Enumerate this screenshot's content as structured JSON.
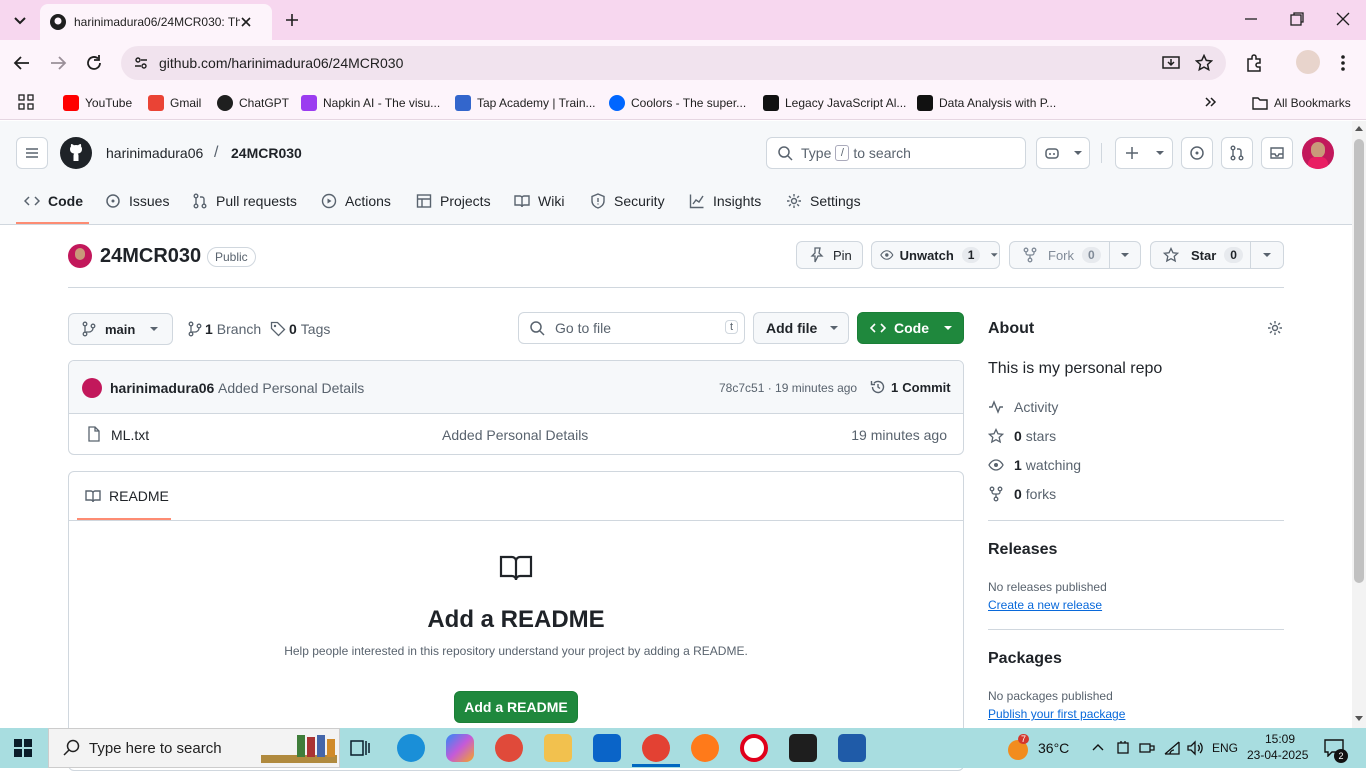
{
  "browser": {
    "tab_title": "harinimadura06/24MCR030: Th",
    "url": "github.com/harinimadura06/24MCR030",
    "bookmarks": [
      {
        "label": "YouTube",
        "color": "#ff0000"
      },
      {
        "label": "Gmail",
        "color": "#ea4335"
      },
      {
        "label": "ChatGPT",
        "color": "#1f1f1f"
      },
      {
        "label": "Napkin AI - The visu...",
        "color": "#9b3cf0"
      },
      {
        "label": "Tap Academy | Train...",
        "color": "#3366cc"
      },
      {
        "label": "Coolors - The super...",
        "color": "#0066ff"
      },
      {
        "label": "Legacy JavaScript Al...",
        "color": "#111111"
      },
      {
        "label": "Data Analysis with P...",
        "color": "#111111"
      }
    ],
    "all_bookmarks": "All Bookmarks"
  },
  "header": {
    "owner": "harinimadura06",
    "separator": "/",
    "repo": "24MCR030",
    "search_prefix": "Type",
    "search_key": "/",
    "search_suffix": "to search"
  },
  "nav": [
    {
      "label": "Code",
      "icon": "code-icon"
    },
    {
      "label": "Issues",
      "icon": "issue-icon"
    },
    {
      "label": "Pull requests",
      "icon": "pull-request-icon"
    },
    {
      "label": "Actions",
      "icon": "play-icon"
    },
    {
      "label": "Projects",
      "icon": "table-icon"
    },
    {
      "label": "Wiki",
      "icon": "book-icon"
    },
    {
      "label": "Security",
      "icon": "shield-icon"
    },
    {
      "label": "Insights",
      "icon": "graph-icon"
    },
    {
      "label": "Settings",
      "icon": "gear-icon"
    }
  ],
  "repo": {
    "name": "24MCR030",
    "visibility": "Public",
    "pin": "Pin",
    "unwatch": "Unwatch",
    "watch_count": "1",
    "fork": "Fork",
    "fork_count": "0",
    "star": "Star",
    "star_count": "0"
  },
  "toolbar": {
    "branch": "main",
    "branches_count": "1",
    "branches_label": "Branch",
    "tags_count": "0",
    "tags_label": "Tags",
    "goto_placeholder": "Go to file",
    "goto_key": "t",
    "add_file": "Add file",
    "code": "Code"
  },
  "commit": {
    "author": "harinimadura06",
    "message": "Added Personal Details",
    "hash_time": "78c7c51 · 19 minutes ago",
    "commits_count": "1",
    "commits_label": "Commit"
  },
  "files": [
    {
      "name": "ML.txt",
      "message": "Added Personal Details",
      "time": "19 minutes ago"
    }
  ],
  "readme": {
    "tab": "README",
    "heading": "Add a README",
    "description": "Help people interested in this repository understand your project by adding a README.",
    "button": "Add a README"
  },
  "about": {
    "title": "About",
    "description": "This is my personal repo",
    "activity": "Activity",
    "stars_count": "0",
    "stars_label": "stars",
    "watching_count": "1",
    "watching_label": "watching",
    "forks_count": "0",
    "forks_label": "forks"
  },
  "releases": {
    "title": "Releases",
    "none": "No releases published",
    "link": "Create a new release"
  },
  "packages": {
    "title": "Packages",
    "none": "No packages published",
    "link": "Publish your first package"
  },
  "taskbar": {
    "search": "Type here to search",
    "weather_badge": "7",
    "temperature": "36°C",
    "language": "ENG",
    "time": "15:09",
    "date": "23-04-2025",
    "notification_count": "2"
  }
}
